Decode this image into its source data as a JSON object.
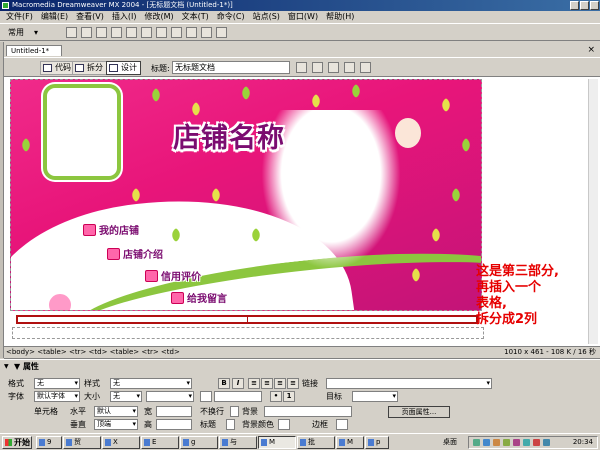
{
  "window": {
    "title": "Macromedia Dreamweaver MX 2004 - [无标题文档 (Untitled-1*)]"
  },
  "menu": [
    "文件(F)",
    "编辑(E)",
    "查看(V)",
    "插入(I)",
    "修改(M)",
    "文本(T)",
    "命令(C)",
    "站点(S)",
    "窗口(W)",
    "帮助(H)"
  ],
  "insertbar": {
    "category": "常用"
  },
  "document": {
    "tab": "Untitled-1*",
    "views": {
      "code": "代码",
      "split": "拆分",
      "design": "设计"
    },
    "title_label": "标题:",
    "title_value": "无标题文档"
  },
  "banner": {
    "shop_name": "店铺名称",
    "nav": [
      "我的店铺",
      "店铺介绍",
      "信用评价",
      "给我留言"
    ]
  },
  "annotation": [
    "这是第三部分,",
    "再插入一个",
    "表格,",
    "拆分成2列"
  ],
  "status": {
    "tags": "<body> <table> <tr> <td> <table> <tr> <td>",
    "dims": "1010 x 461 - 108 K / 16 秒"
  },
  "properties": {
    "header": "▼ 属性",
    "format_label": "格式",
    "format_value": "无",
    "style_label": "样式",
    "style_value": "无",
    "link_label": "链接",
    "font_label": "字体",
    "font_value": "默认字体",
    "size_label": "大小",
    "size_value": "无",
    "target_label": "目标",
    "cell_label": "单元格",
    "horz_label": "水平",
    "horz_value": "默认",
    "width_label": "宽",
    "nowrap_label": "不换行",
    "bg_label": "背景",
    "vert_label": "垂直",
    "vert_value": "顶端",
    "height_label": "高",
    "header_label": "标题",
    "bgcolor_label": "背景颜色",
    "border_label": "边框",
    "page_props": "页面属性..."
  },
  "taskbar": {
    "start": "开始",
    "items": [
      "9",
      "贸",
      "X",
      "E",
      "g",
      "与",
      "M",
      "批",
      "M",
      "p"
    ],
    "desktop": "桌面",
    "clock": "20:34"
  }
}
